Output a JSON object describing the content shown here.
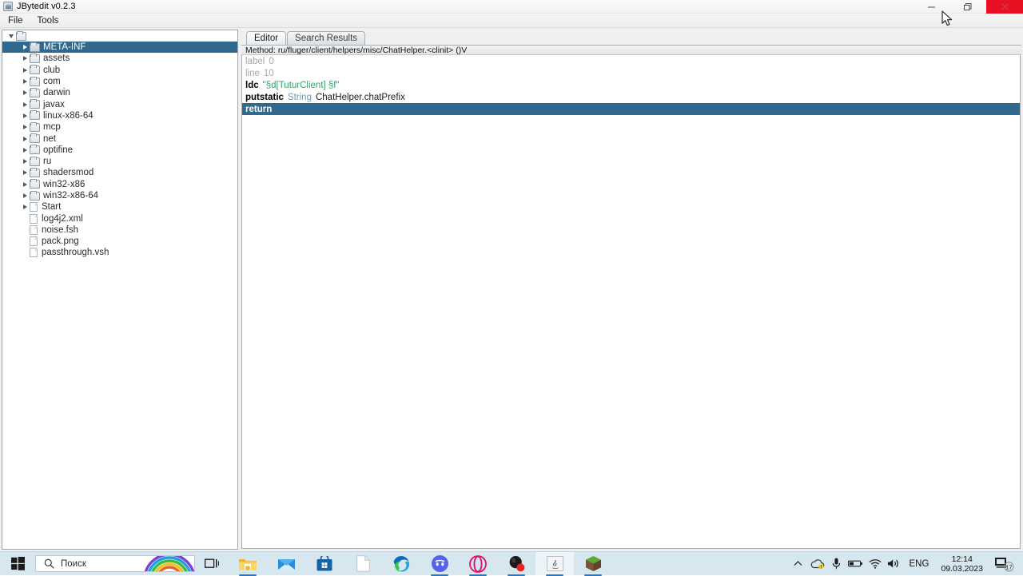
{
  "window": {
    "title": "JBytedit v0.2.3",
    "icon": "app-icon",
    "caption": {
      "minimize": "minimize-icon",
      "maximize": "restore-icon",
      "close": "close-icon",
      "close_bg": "#e81123"
    }
  },
  "menubar": {
    "items": [
      {
        "label": "File"
      },
      {
        "label": "Tools"
      }
    ]
  },
  "tree": {
    "root": {
      "icon": "folder-icon",
      "expanded": true
    },
    "selection_color": "#31688e",
    "nodes": [
      {
        "label": "META-INF",
        "type": "folder",
        "expandable": true,
        "selected": true
      },
      {
        "label": "assets",
        "type": "folder",
        "expandable": true,
        "selected": false
      },
      {
        "label": "club",
        "type": "folder",
        "expandable": true,
        "selected": false
      },
      {
        "label": "com",
        "type": "folder",
        "expandable": true,
        "selected": false
      },
      {
        "label": "darwin",
        "type": "folder",
        "expandable": true,
        "selected": false
      },
      {
        "label": "javax",
        "type": "folder",
        "expandable": true,
        "selected": false
      },
      {
        "label": "linux-x86-64",
        "type": "folder",
        "expandable": true,
        "selected": false
      },
      {
        "label": "mcp",
        "type": "folder",
        "expandable": true,
        "selected": false
      },
      {
        "label": "net",
        "type": "folder",
        "expandable": true,
        "selected": false
      },
      {
        "label": "optifine",
        "type": "folder",
        "expandable": true,
        "selected": false
      },
      {
        "label": "ru",
        "type": "folder",
        "expandable": true,
        "selected": false
      },
      {
        "label": "shadersmod",
        "type": "folder",
        "expandable": true,
        "selected": false
      },
      {
        "label": "win32-x86",
        "type": "folder",
        "expandable": true,
        "selected": false
      },
      {
        "label": "win32-x86-64",
        "type": "folder",
        "expandable": true,
        "selected": false
      },
      {
        "label": "Start",
        "type": "file",
        "expandable": true,
        "selected": false
      },
      {
        "label": "log4j2.xml",
        "type": "file",
        "expandable": false,
        "selected": false
      },
      {
        "label": "noise.fsh",
        "type": "file",
        "expandable": false,
        "selected": false
      },
      {
        "label": "pack.png",
        "type": "file",
        "expandable": false,
        "selected": false
      },
      {
        "label": "passthrough.vsh",
        "type": "file",
        "expandable": false,
        "selected": false
      }
    ]
  },
  "editor": {
    "tabs": [
      {
        "label": "Editor",
        "active": true
      },
      {
        "label": "Search Results",
        "active": false
      }
    ],
    "method_bar": "Method: ru/fluger/client/helpers/misc/ChatHelper.<clinit> ()V",
    "code": [
      {
        "op": "label",
        "op_dim": true,
        "arg1": "0",
        "arg1_kind": "num",
        "arg2": "",
        "selected": false
      },
      {
        "op": "line",
        "op_dim": true,
        "arg1": "10",
        "arg1_kind": "num",
        "arg2": "",
        "selected": false
      },
      {
        "op": "ldc",
        "op_dim": false,
        "arg1": "\"§d[TuturClient] §f\"",
        "arg1_kind": "str",
        "arg2": "",
        "selected": false
      },
      {
        "op": "putstatic",
        "op_dim": false,
        "arg1": "String",
        "arg1_kind": "type",
        "arg2": "ChatHelper.chatPrefix",
        "selected": false
      },
      {
        "op": "return",
        "op_dim": false,
        "arg1": "",
        "arg1_kind": "plain",
        "arg2": "",
        "selected": true
      }
    ]
  },
  "taskbar": {
    "start": "windows-start-icon",
    "search": {
      "placeholder": "Поиск",
      "icon": "search-icon"
    },
    "taskview": "task-view-icon",
    "apps": [
      {
        "name": "file-explorer",
        "icon": "folder-icon",
        "running": true,
        "active": false
      },
      {
        "name": "mail",
        "icon": "mail-icon",
        "running": false,
        "active": false
      },
      {
        "name": "microsoft-store",
        "icon": "store-icon",
        "running": false,
        "active": false
      },
      {
        "name": "notepad",
        "icon": "document-icon",
        "running": false,
        "active": false
      },
      {
        "name": "microsoft-edge",
        "icon": "edge-icon",
        "running": false,
        "active": false
      },
      {
        "name": "discord",
        "icon": "discord-icon",
        "running": true,
        "active": false
      },
      {
        "name": "opera-gx",
        "icon": "opera-icon",
        "running": true,
        "active": false
      },
      {
        "name": "obs-studio",
        "icon": "obs-icon",
        "running": true,
        "active": false
      },
      {
        "name": "jbytedit",
        "icon": "java-icon",
        "running": true,
        "active": true
      },
      {
        "name": "minecraft",
        "icon": "minecraft-icon",
        "running": true,
        "active": false
      }
    ],
    "tray": {
      "chevron": "show-hidden-icons-icon",
      "items": [
        {
          "name": "onedrive-icon"
        },
        {
          "name": "microphone-icon"
        },
        {
          "name": "battery-icon"
        },
        {
          "name": "wifi-icon"
        },
        {
          "name": "volume-icon"
        }
      ],
      "language": "ENG",
      "time": "12:14",
      "date": "09.03.2023",
      "notifications": {
        "icon": "notification-icon",
        "count": "17"
      }
    }
  }
}
